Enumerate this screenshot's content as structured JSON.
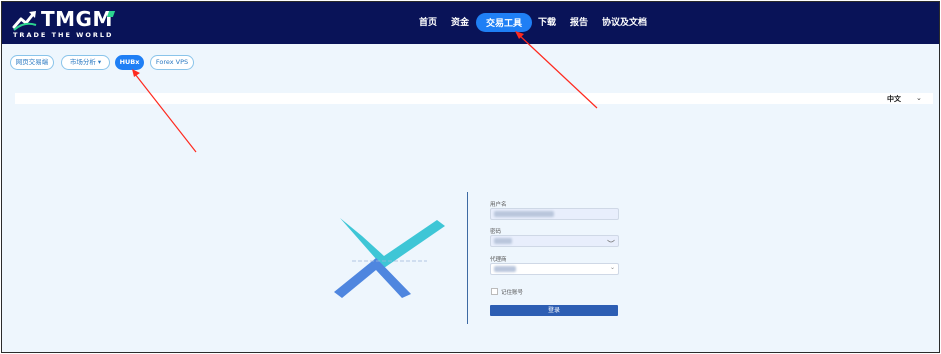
{
  "brand": {
    "name": "TMGM",
    "tagline": "TRADE THE WORLD"
  },
  "nav": {
    "items": [
      {
        "label": "首页"
      },
      {
        "label": "资金"
      },
      {
        "label": "交易工具"
      },
      {
        "label": "下载"
      },
      {
        "label": "报告"
      },
      {
        "label": "协议及文档"
      }
    ],
    "active_item": "交易工具"
  },
  "subtabs": {
    "items": [
      {
        "label": "网页交易端"
      },
      {
        "label": "市场分析 ▾"
      },
      {
        "label": "HUBx"
      },
      {
        "label": "Forex VPS"
      }
    ],
    "active_item": "HUBx"
  },
  "language": {
    "value": "中文",
    "chevron": "⌄"
  },
  "login": {
    "username_label": "用户名",
    "username_value": "xxxxxxxxxxxxxxx",
    "password_label": "密码",
    "password_value": "xxxxxxx",
    "broker_label": "代理商",
    "broker_value": "xxxxxx",
    "broker_chevron": "⌄",
    "remember_label": "记住账号",
    "submit_label": "登录"
  },
  "colors": {
    "topbar": "#091358",
    "accent": "#1f7ff5",
    "annotation_arrow": "#ff2a1f",
    "emblem_teal": "#3ec6d6",
    "emblem_blue": "#4f86df",
    "login_button": "#2d5eb3"
  },
  "icons": {
    "logo": "tmgm-chart-arrow-logo",
    "password_toggle": "eye-icon",
    "emblem": "hubx-x-logo"
  }
}
